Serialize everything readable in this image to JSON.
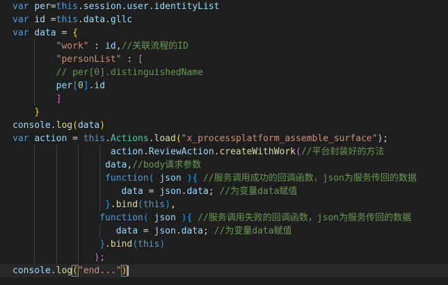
{
  "editor": {
    "lines": [
      {
        "segments": [
          {
            "t": "var ",
            "c": "kw"
          },
          {
            "t": "per",
            "c": "var"
          },
          {
            "t": "=",
            "c": "punc"
          },
          {
            "t": "this",
            "c": "kw"
          },
          {
            "t": ".",
            "c": "punc"
          },
          {
            "t": "session",
            "c": "var"
          },
          {
            "t": ".",
            "c": "punc"
          },
          {
            "t": "user",
            "c": "var"
          },
          {
            "t": ".",
            "c": "punc"
          },
          {
            "t": "identityList",
            "c": "var"
          }
        ]
      },
      {
        "segments": [
          {
            "t": "var ",
            "c": "kw"
          },
          {
            "t": "id",
            "c": "var"
          },
          {
            "t": " =",
            "c": "punc"
          },
          {
            "t": "this",
            "c": "kw"
          },
          {
            "t": ".",
            "c": "punc"
          },
          {
            "t": "data",
            "c": "var"
          },
          {
            "t": ".",
            "c": "punc"
          },
          {
            "t": "gllc",
            "c": "var"
          }
        ]
      },
      {
        "segments": [
          {
            "t": "var ",
            "c": "kw"
          },
          {
            "t": "data",
            "c": "var"
          },
          {
            "t": " = ",
            "c": "punc"
          },
          {
            "t": "{",
            "c": "br1"
          }
        ]
      },
      {
        "segments": [
          {
            "t": "        ",
            "c": "punc"
          },
          {
            "t": "\"work\"",
            "c": "str"
          },
          {
            "t": " : ",
            "c": "punc"
          },
          {
            "t": "id",
            "c": "var"
          },
          {
            "t": ",",
            "c": "punc"
          },
          {
            "t": "//关联流程的ID",
            "c": "cmt"
          }
        ]
      },
      {
        "segments": [
          {
            "t": "        ",
            "c": "punc"
          },
          {
            "t": "\"personList\"",
            "c": "str"
          },
          {
            "t": " : ",
            "c": "punc"
          },
          {
            "t": "[",
            "c": "br2"
          }
        ]
      },
      {
        "segments": [
          {
            "t": "        ",
            "c": "punc"
          },
          {
            "t": "// per[0].distinguishedName",
            "c": "cmt"
          }
        ]
      },
      {
        "segments": [
          {
            "t": "        ",
            "c": "punc"
          },
          {
            "t": "per",
            "c": "var"
          },
          {
            "t": "[",
            "c": "br3"
          },
          {
            "t": "0",
            "c": "num"
          },
          {
            "t": "]",
            "c": "br3"
          },
          {
            "t": ".",
            "c": "punc"
          },
          {
            "t": "id",
            "c": "var"
          }
        ]
      },
      {
        "segments": [
          {
            "t": "        ",
            "c": "punc"
          },
          {
            "t": "]",
            "c": "br2"
          }
        ]
      },
      {
        "segments": [
          {
            "t": "    ",
            "c": "punc"
          },
          {
            "t": "}",
            "c": "br1"
          }
        ]
      },
      {
        "segments": [
          {
            "t": "console",
            "c": "var"
          },
          {
            "t": ".",
            "c": "punc"
          },
          {
            "t": "log",
            "c": "fn"
          },
          {
            "t": "(",
            "c": "br1"
          },
          {
            "t": "data",
            "c": "var"
          },
          {
            "t": ")",
            "c": "br1"
          }
        ]
      },
      {
        "segments": [
          {
            "t": "var ",
            "c": "kw"
          },
          {
            "t": "action",
            "c": "var"
          },
          {
            "t": " = ",
            "c": "punc"
          },
          {
            "t": "this",
            "c": "kw"
          },
          {
            "t": ".",
            "c": "punc"
          },
          {
            "t": "Actions",
            "c": "cls"
          },
          {
            "t": ".",
            "c": "punc"
          },
          {
            "t": "load",
            "c": "fn"
          },
          {
            "t": "(",
            "c": "br1"
          },
          {
            "t": "\"x_processplatform_assemble_surface\"",
            "c": "str"
          },
          {
            "t": ");",
            "c": "punc"
          }
        ]
      },
      {
        "segments": [
          {
            "t": "                  ",
            "c": "punc"
          },
          {
            "t": "action",
            "c": "var"
          },
          {
            "t": ".",
            "c": "punc"
          },
          {
            "t": "ReviewAction",
            "c": "var"
          },
          {
            "t": ".",
            "c": "punc"
          },
          {
            "t": "createWithWork",
            "c": "fn"
          },
          {
            "t": "(",
            "c": "br2"
          },
          {
            "t": "//平台封装好的方法",
            "c": "cmt"
          }
        ]
      },
      {
        "segments": [
          {
            "t": "                 ",
            "c": "punc"
          },
          {
            "t": "data",
            "c": "var"
          },
          {
            "t": ",",
            "c": "punc"
          },
          {
            "t": "//body请求参数",
            "c": "cmt"
          }
        ]
      },
      {
        "segments": [
          {
            "t": "                 ",
            "c": "punc"
          },
          {
            "t": "function",
            "c": "kw"
          },
          {
            "t": "( ",
            "c": "br3"
          },
          {
            "t": "json",
            "c": "var"
          },
          {
            "t": " )",
            "c": "br3"
          },
          {
            "t": "{",
            "c": "br3"
          },
          {
            "t": " ",
            "c": "punc"
          },
          {
            "t": "//服务调用成功的回调函数，json为服务传回的数据",
            "c": "cmt"
          }
        ]
      },
      {
        "segments": [
          {
            "t": "                    ",
            "c": "punc"
          },
          {
            "t": "data",
            "c": "var"
          },
          {
            "t": " = ",
            "c": "punc"
          },
          {
            "t": "json",
            "c": "var"
          },
          {
            "t": ".",
            "c": "punc"
          },
          {
            "t": "data",
            "c": "var"
          },
          {
            "t": "; ",
            "c": "punc"
          },
          {
            "t": "//为变量data赋值",
            "c": "cmt"
          }
        ]
      },
      {
        "segments": [
          {
            "t": "                 ",
            "c": "punc"
          },
          {
            "t": "}",
            "c": "br3"
          },
          {
            "t": ".",
            "c": "punc"
          },
          {
            "t": "bind",
            "c": "fn"
          },
          {
            "t": "(",
            "c": "br3"
          },
          {
            "t": "this",
            "c": "kw"
          },
          {
            "t": ")",
            "c": "br3"
          },
          {
            "t": ",",
            "c": "punc"
          }
        ]
      },
      {
        "segments": [
          {
            "t": "                ",
            "c": "punc"
          },
          {
            "t": "function",
            "c": "kw"
          },
          {
            "t": "( ",
            "c": "br3"
          },
          {
            "t": "json",
            "c": "var"
          },
          {
            "t": " )",
            "c": "br3"
          },
          {
            "t": "{",
            "c": "br3"
          },
          {
            "t": " ",
            "c": "punc"
          },
          {
            "t": "//服务调用失败的回调函数，json为服务传回的数据",
            "c": "cmt"
          }
        ]
      },
      {
        "segments": [
          {
            "t": "                   ",
            "c": "punc"
          },
          {
            "t": "data",
            "c": "var"
          },
          {
            "t": " = ",
            "c": "punc"
          },
          {
            "t": "json",
            "c": "var"
          },
          {
            "t": ".",
            "c": "punc"
          },
          {
            "t": "data",
            "c": "var"
          },
          {
            "t": "; ",
            "c": "punc"
          },
          {
            "t": "//为变量data赋值",
            "c": "cmt"
          }
        ]
      },
      {
        "segments": [
          {
            "t": "                ",
            "c": "punc"
          },
          {
            "t": "}",
            "c": "br3"
          },
          {
            "t": ".",
            "c": "punc"
          },
          {
            "t": "bind",
            "c": "fn"
          },
          {
            "t": "(",
            "c": "br3"
          },
          {
            "t": "this",
            "c": "kw"
          },
          {
            "t": ")",
            "c": "br3"
          }
        ]
      },
      {
        "segments": [
          {
            "t": "               ",
            "c": "punc"
          },
          {
            "t": ");",
            "c": "br2"
          }
        ]
      },
      {
        "segments": [
          {
            "t": "console",
            "c": "var"
          },
          {
            "t": ".",
            "c": "punc"
          },
          {
            "t": "log",
            "c": "fn"
          },
          {
            "t": "(",
            "c": "brm"
          },
          {
            "t": "\"end...\"",
            "c": "str"
          },
          {
            "t": ")",
            "c": "brm"
          }
        ]
      }
    ]
  },
  "theme": {
    "background": "#1e1e1e",
    "keyword": "#569cd6",
    "variable": "#9cdcfe",
    "function": "#dcdcaa",
    "string": "#ce9178",
    "comment": "#6a9955",
    "number": "#b5cea8",
    "class": "#4ec9b0",
    "bracket_level_1": "#ffd700",
    "bracket_level_2": "#da70d6",
    "bracket_level_3": "#179fff"
  }
}
